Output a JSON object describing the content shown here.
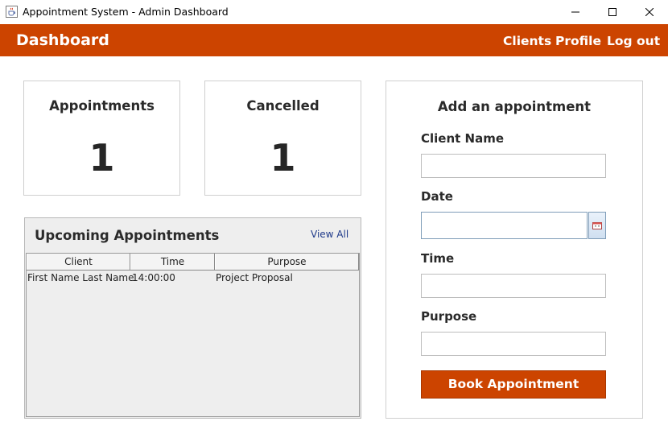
{
  "window": {
    "title": "Appointment System - Admin Dashboard",
    "icon": "java-cup-icon",
    "controls": [
      "minimize-icon",
      "maximize-icon",
      "close-icon"
    ]
  },
  "header": {
    "brand": "Dashboard",
    "nav": {
      "clients": "Clients",
      "profile": "Profile",
      "logout": "Log out"
    },
    "accent_color": "#cc4400"
  },
  "stats": {
    "appointments": {
      "label": "Appointments",
      "value": "1"
    },
    "cancelled": {
      "label": "Cancelled",
      "value": "1"
    }
  },
  "upcoming": {
    "title": "Upcoming Appointments",
    "view_all": "View All",
    "columns": [
      "Client",
      "Time",
      "Purpose"
    ],
    "rows": [
      [
        "First Name Last Name",
        "14:00:00",
        "Project Proposal"
      ]
    ]
  },
  "form": {
    "title": "Add an appointment",
    "client_label": "Client Name",
    "client_value": "",
    "date_label": "Date",
    "date_value": "",
    "date_picker_icon": "calendar-icon",
    "time_label": "Time",
    "time_value": "",
    "purpose_label": "Purpose",
    "purpose_value": "",
    "submit_label": "Book Appointment"
  }
}
